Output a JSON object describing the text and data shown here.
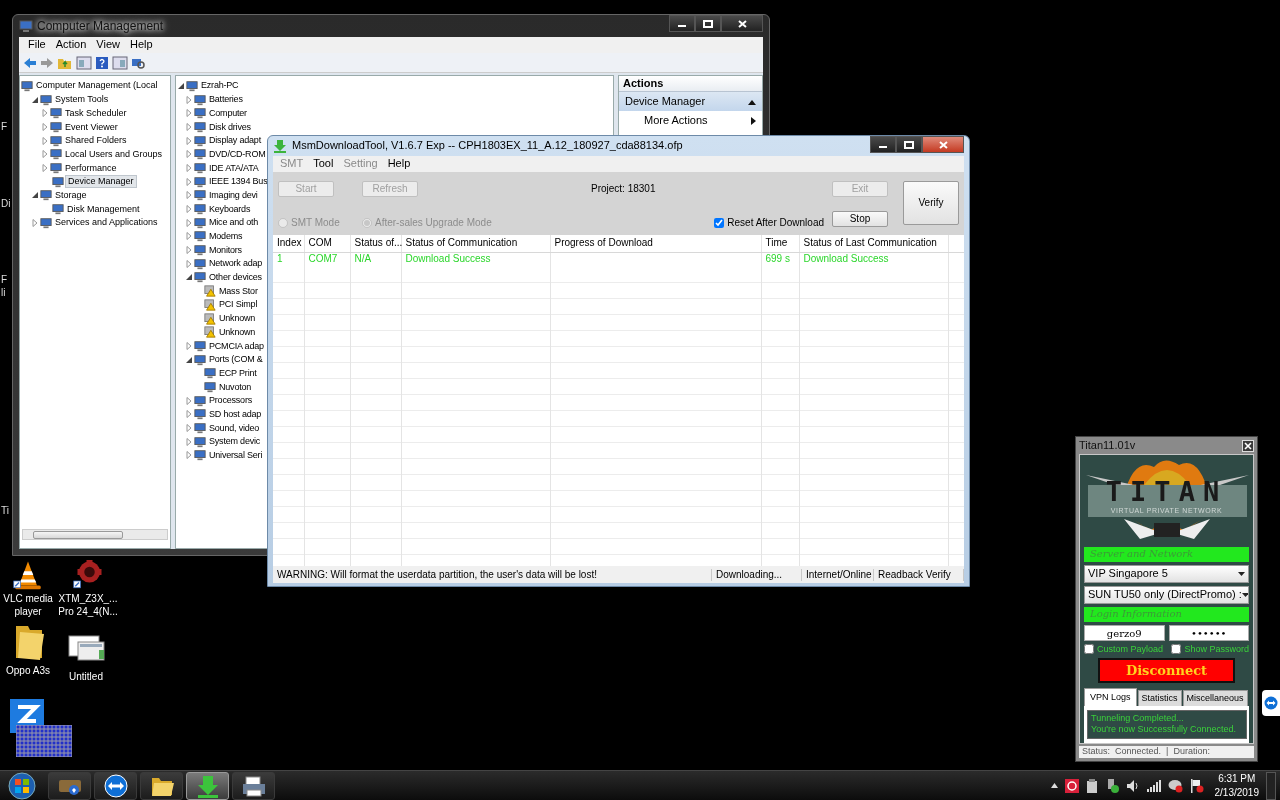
{
  "computer_management": {
    "title": "Computer Management",
    "menu": [
      "File",
      "Action",
      "View",
      "Help"
    ],
    "tree": [
      {
        "label": "Computer Management (Local",
        "selected": false,
        "children": [
          {
            "label": "System Tools",
            "selected": false,
            "expanded": true,
            "children": [
              {
                "label": "Task Scheduler",
                "selected": false,
                "expanded": false
              },
              {
                "label": "Event Viewer",
                "selected": false,
                "expanded": false
              },
              {
                "label": "Shared Folders",
                "selected": false,
                "expanded": false
              },
              {
                "label": "Local Users and Groups",
                "selected": false,
                "expanded": false
              },
              {
                "label": "Performance",
                "selected": false,
                "expanded": false
              },
              {
                "label": "Device Manager",
                "selected": true
              }
            ]
          },
          {
            "label": "Storage",
            "selected": false,
            "expanded": true,
            "children": [
              {
                "label": "Disk Management",
                "selected": false
              }
            ]
          },
          {
            "label": "Services and Applications",
            "selected": false,
            "expanded": false
          }
        ]
      }
    ],
    "devices": [
      {
        "label": "Ezrah-PC",
        "expanded": true,
        "children": [
          {
            "label": "Batteries",
            "expanded": false
          },
          {
            "label": "Computer",
            "expanded": false
          },
          {
            "label": "Disk drives",
            "expanded": false
          },
          {
            "label": "Display adapt",
            "expanded": false
          },
          {
            "label": "DVD/CD-ROM",
            "expanded": false
          },
          {
            "label": "IDE ATA/ATA",
            "expanded": false
          },
          {
            "label": "IEEE 1394 Bus",
            "expanded": false
          },
          {
            "label": "Imaging devi",
            "expanded": false
          },
          {
            "label": "Keyboards",
            "expanded": false
          },
          {
            "label": "Mice and oth",
            "expanded": false
          },
          {
            "label": "Modems",
            "expanded": false
          },
          {
            "label": "Monitors",
            "expanded": false
          },
          {
            "label": "Network adap",
            "expanded": false
          },
          {
            "label": "Other devices",
            "expanded": true,
            "children": [
              {
                "label": "Mass Stor",
                "warning": true
              },
              {
                "label": "PCI Simpl",
                "warning": true
              },
              {
                "label": "Unknown",
                "warning": true
              },
              {
                "label": "Unknown",
                "warning": true
              }
            ]
          },
          {
            "label": "PCMCIA adap",
            "expanded": false
          },
          {
            "label": "Ports (COM &",
            "expanded": true,
            "children": [
              {
                "label": "ECP Print",
                "warning": false
              },
              {
                "label": "Nuvoton",
                "warning": false
              }
            ]
          },
          {
            "label": "Processors",
            "expanded": false
          },
          {
            "label": "SD host adap",
            "expanded": false
          },
          {
            "label": "Sound, video",
            "expanded": false
          },
          {
            "label": "System devic",
            "expanded": false
          },
          {
            "label": "Universal Seri",
            "expanded": false
          }
        ]
      }
    ],
    "actions": {
      "title": "Actions",
      "section": "Device Manager",
      "items": [
        "More Actions"
      ]
    }
  },
  "msm_tool": {
    "title": "MsmDownloadTool, V1.6.7 Exp -- CPH1803EX_11_A.12_180927_cda88134.ofp",
    "menu": [
      {
        "label": "SMT",
        "disabled": true
      },
      {
        "label": "Tool",
        "disabled": false
      },
      {
        "label": "Setting",
        "disabled": true
      },
      {
        "label": "Help",
        "disabled": false
      }
    ],
    "start": {
      "label": "Start",
      "disabled": true
    },
    "refresh": {
      "label": "Refresh",
      "disabled": true
    },
    "project": "Project: 18301",
    "exit": {
      "label": "Exit",
      "disabled": true
    },
    "stop": {
      "label": "Stop",
      "disabled": false
    },
    "verify": {
      "label": "Verify",
      "disabled": false
    },
    "modes": [
      {
        "label": "SMT Mode",
        "selected": false,
        "disabled": true
      },
      {
        "label": "After-sales Upgrade Mode",
        "selected": true,
        "disabled": true
      }
    ],
    "reset_after_download": {
      "label": "Reset After Download",
      "checked": true
    },
    "table": {
      "columns": [
        "Index",
        "COM",
        "Status of...",
        "Status of Communication",
        "Progress of Download",
        "Time",
        "Status of Last Communication"
      ],
      "rows": [
        {
          "cells": [
            "1",
            "COM7",
            "N/A",
            "Download Success",
            "",
            "699 s",
            "Download Success"
          ]
        }
      ]
    },
    "status_bar": [
      "WARNING: Will format the userdata partition, the user's data will be lost!",
      "Downloading...",
      "Internet/Online",
      "Readback Verify"
    ]
  },
  "titan": {
    "title": "Titan11.01v",
    "logo": {
      "title": "TITAN",
      "subtitle": "VIRTUAL PRIVATE NETWORK"
    },
    "server_label": "Server and Network",
    "server": "VIP Singapore 5",
    "promo": "SUN TU50 only (DirectPromo) :",
    "login_label": "Login Information",
    "username": "gerzo9",
    "password": "••••••",
    "options": [
      {
        "label": "Custom Payload",
        "checked": false
      },
      {
        "label": "Show Password",
        "checked": false
      }
    ],
    "button": "Disconnect",
    "tabs": [
      {
        "label": "VPN Logs",
        "selected": true
      },
      {
        "label": "Statistics",
        "selected": false
      },
      {
        "label": "Miscellaneous",
        "selected": false
      }
    ],
    "log": [
      "Tunneling Completed...",
      "You're now Successfully Connected."
    ],
    "status": "Status:  Connected.  |  Duration:"
  },
  "desktop": {
    "edge_fragments": [
      "F",
      "Di",
      "F",
      "li",
      "Ti"
    ],
    "icons": [
      {
        "label": "VLC media player",
        "kind": "cone"
      },
      {
        "label": "XTM_Z3X_... Pro 24_4(N...",
        "kind": "gear"
      },
      {
        "label": "Oppo A3s",
        "kind": "folder"
      },
      {
        "label": "Untitled",
        "kind": "screenshot"
      },
      {
        "kind": "app"
      }
    ]
  },
  "taskbar": {
    "apps": [
      {
        "kind": "game",
        "selected": false
      },
      {
        "kind": "teamviewer",
        "selected": false
      },
      {
        "kind": "folder",
        "selected": false
      },
      {
        "kind": "download",
        "selected": true
      },
      {
        "kind": "printer",
        "selected": false
      }
    ],
    "time": "6:31 PM",
    "date": "2/13/2019"
  }
}
